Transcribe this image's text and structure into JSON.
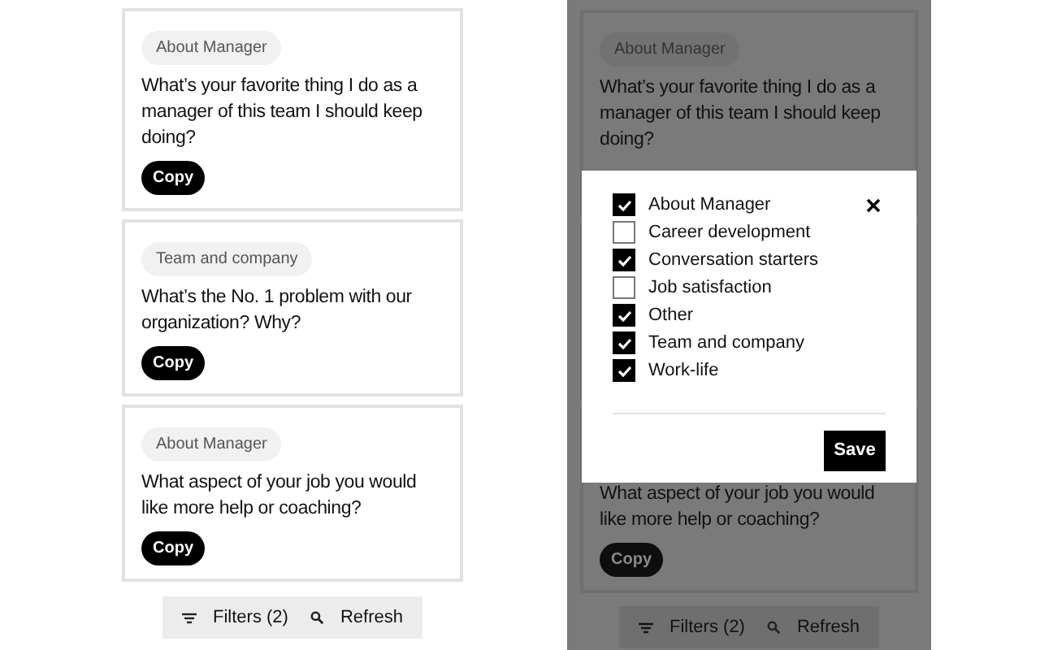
{
  "left_screen": {
    "cards": [
      {
        "tag": "About Manager",
        "question": "What’s your favorite thing I do as a manager of this team I should keep doing?",
        "button": "Copy"
      },
      {
        "tag": "Team and company",
        "question": "What’s the No. 1 problem with our organization? Why?",
        "button": "Copy"
      },
      {
        "tag": "About Manager",
        "question": "What aspect of your job you would like more help or coaching?",
        "button": "Copy"
      }
    ],
    "toolbar": {
      "filters": "Filters (2)",
      "refresh": "Refresh"
    }
  },
  "right_screen": {
    "cards": [
      {
        "tag": "About Manager",
        "question": "What’s your favorite thing I do as a manager of this team I should keep doing?"
      },
      {
        "question": "What aspect of your job you would like more help or coaching?",
        "button": "Copy"
      }
    ],
    "toolbar": {
      "filters": "Filters (2)",
      "refresh": "Refresh"
    },
    "filter_dialog": {
      "options": [
        {
          "label": "About Manager",
          "checked": true
        },
        {
          "label": "Career development",
          "checked": false
        },
        {
          "label": "Conversation starters",
          "checked": true
        },
        {
          "label": "Job satisfaction",
          "checked": false
        },
        {
          "label": "Other",
          "checked": true
        },
        {
          "label": "Team and company",
          "checked": true
        },
        {
          "label": "Work-life",
          "checked": true
        }
      ],
      "save": "Save"
    }
  }
}
